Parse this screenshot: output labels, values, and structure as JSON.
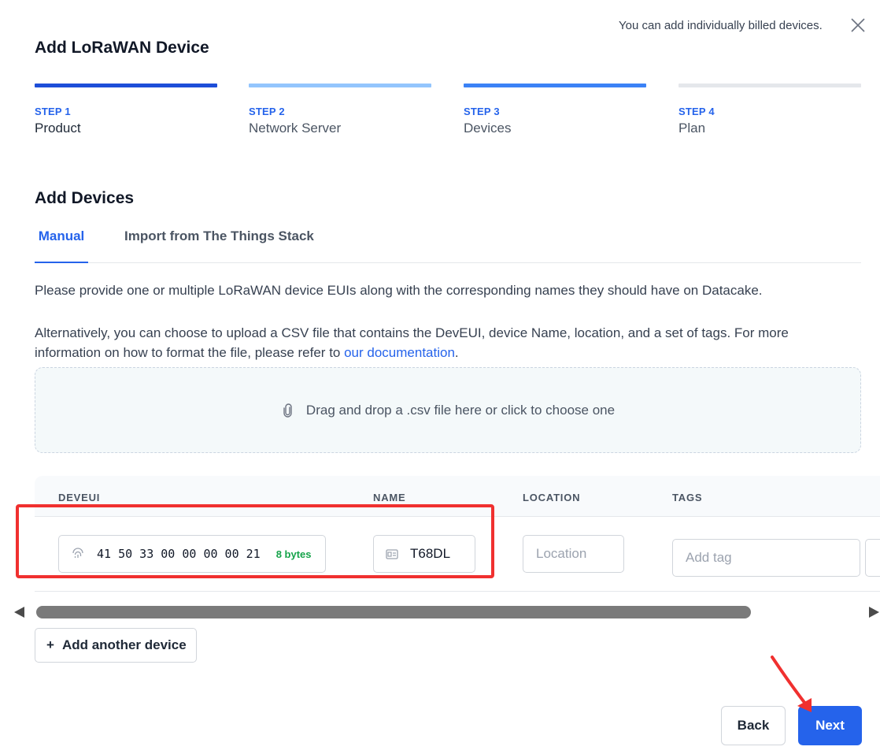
{
  "header": {
    "notice": "You can add individually billed devices.",
    "title": "Add LoRaWAN Device"
  },
  "steps": [
    {
      "step": "STEP 1",
      "name": "Product",
      "bar_color": "#1d4ed8"
    },
    {
      "step": "STEP 2",
      "name": "Network Server",
      "bar_color": "#93c5fd"
    },
    {
      "step": "STEP 3",
      "name": "Devices",
      "bar_color": "#3b82f6"
    },
    {
      "step": "STEP 4",
      "name": "Plan",
      "bar_color": "#e5e7eb"
    }
  ],
  "section": {
    "title": "Add Devices",
    "tabs": [
      "Manual",
      "Import from The Things Stack"
    ],
    "para1": "Please provide one or multiple LoRaWAN device EUIs along with the corresponding names they should have on Datacake.",
    "para2_text": "Alternatively, you can choose to upload a CSV file that contains the DevEUI, device Name, location, and a set of tags. For more information on how to format the file, please refer to ",
    "para2_link": "our documentation",
    "para2_end": ".",
    "dropzone": "Drag and drop a .csv file here or click to choose one"
  },
  "table": {
    "headers": [
      "DEVEUI",
      "NAME",
      "LOCATION",
      "TAGS"
    ],
    "row": {
      "deveui": "41 50 33 00 00 00 00 21",
      "bytes": "8 bytes",
      "name": "T68DL",
      "location_placeholder": "Location",
      "tag_placeholder": "Add tag"
    }
  },
  "actions": {
    "add_device": "Add another device",
    "add_icon": "+",
    "back": "Back",
    "next": "Next"
  },
  "colors": {
    "accent": "#2563eb",
    "highlight": "#f0302f",
    "success": "#16a34a"
  }
}
